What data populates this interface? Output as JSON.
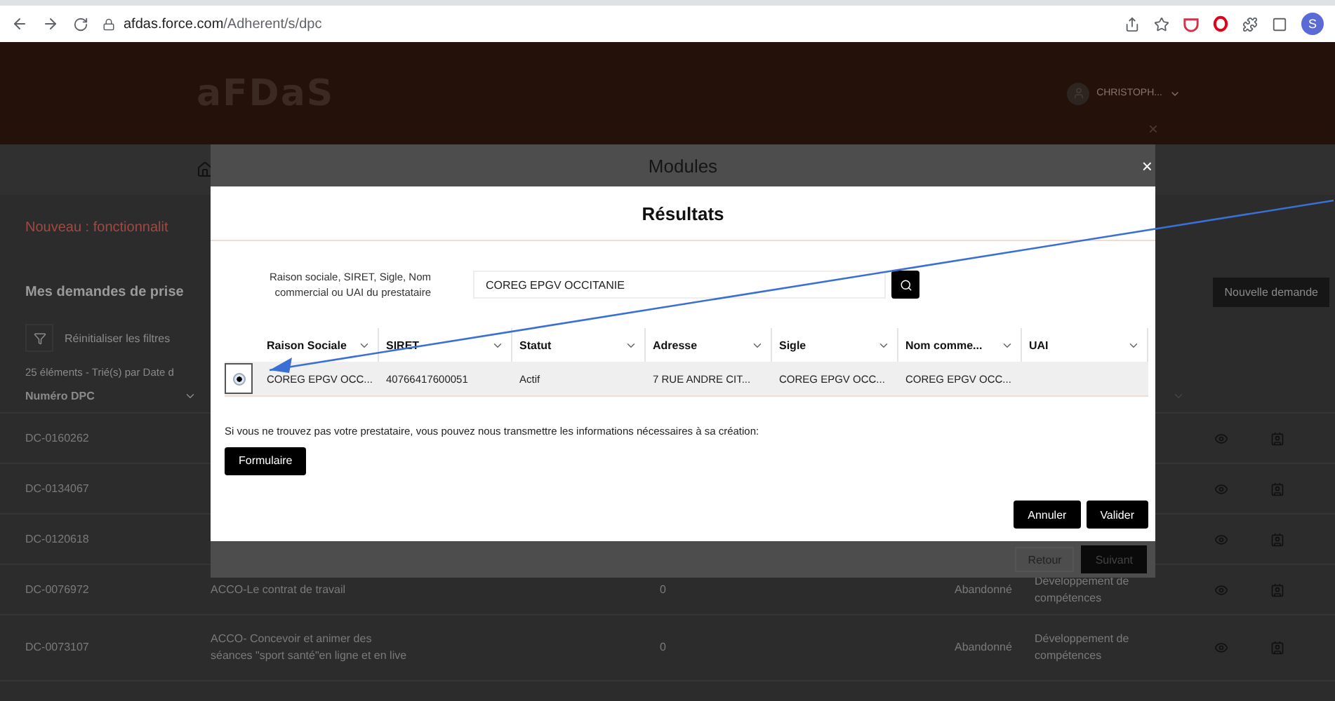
{
  "browser": {
    "url_host": "afdas.force.com",
    "url_path": "/Adherent/s/dpc",
    "profile_initial": "S"
  },
  "header": {
    "logo": "aFDaS",
    "user": "CHRISTOPH...",
    "close": "×"
  },
  "page": {
    "banner": "Nouveau : fonctionnalit",
    "title": "Mes demandes de prise",
    "new_button": "Nouvelle demande",
    "filter_reset": "Réinitialiser les filtres",
    "summary": "25 éléments - Trié(s) par Date d",
    "first_column": "Numéro DPC",
    "rows": [
      {
        "number": "DC-0160262"
      },
      {
        "number": "DC-0134067"
      },
      {
        "number": "DC-0120618"
      },
      {
        "number": "DC-0076972",
        "title": "ACCO-Le contrat de travail",
        "count": "0",
        "status": "Abandonné",
        "type": "Développement de compétences"
      },
      {
        "number": "DC-0073107",
        "title": "ACCO- Concevoir et animer des séances \"sport santé\"en ligne et en live",
        "count": "0",
        "status": "Abandonné",
        "type": "Développement de compétences"
      }
    ]
  },
  "modules_dialog": {
    "title": "Modules",
    "close": "×",
    "back": "Retour",
    "next": "Suivant"
  },
  "results_dialog": {
    "title": "Résultats",
    "search_label": "Raison sociale, SIRET, Sigle, Nom commercial ou UAI du prestataire",
    "search_value": "COREG EPGV OCCITANIE",
    "columns": [
      "Raison Sociale",
      "SIRET",
      "Statut",
      "Adresse",
      "Sigle",
      "Nom comme...",
      "UAI"
    ],
    "rows": [
      {
        "selected": true,
        "cells": [
          "COREG EPGV OCC...",
          "40766417600051",
          "Actif",
          "7 RUE ANDRE CIT...",
          "COREG EPGV OCC...",
          "COREG EPGV OCC...",
          ""
        ]
      }
    ],
    "notice": "Si vous ne trouvez pas votre prestataire, vous pouvez nous transmettre les informations nécessaires à sa création:",
    "form_button": "Formulaire",
    "cancel": "Annuler",
    "confirm": "Valider"
  }
}
